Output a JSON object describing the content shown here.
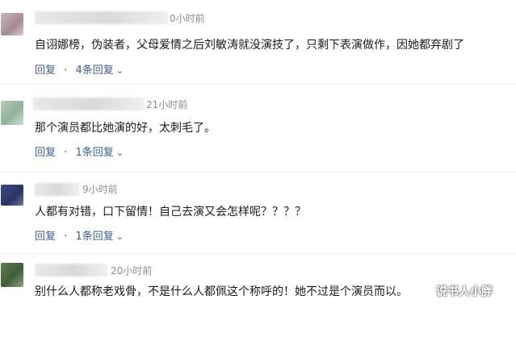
{
  "comments": [
    {
      "time": "0小时前",
      "text": "自诩娜榜，伪装者，父母爱情之后刘敏涛就没演技了，只剩下表演做作，因她都弃剧了",
      "reply_label": "回复",
      "replies_label": "4条回复"
    },
    {
      "time": "21小时前",
      "text": "那个演员都比她演的好，太刺毛了。",
      "reply_label": "回复",
      "replies_label": "1条回复"
    },
    {
      "time": "9小时前",
      "text": "人都有对错，口下留情！自己去演又会怎样呢？？？？",
      "reply_label": "回复",
      "replies_label": "1条回复"
    },
    {
      "time": "20小时前",
      "text": "别什么人都称老戏骨，不是什么人都佩这个称呼的！她不过是个演员而以。",
      "reply_label": "",
      "replies_label": ""
    }
  ],
  "separator": "·",
  "expand_icon": "chevron-down-icon",
  "watermark": "说书人小胖"
}
